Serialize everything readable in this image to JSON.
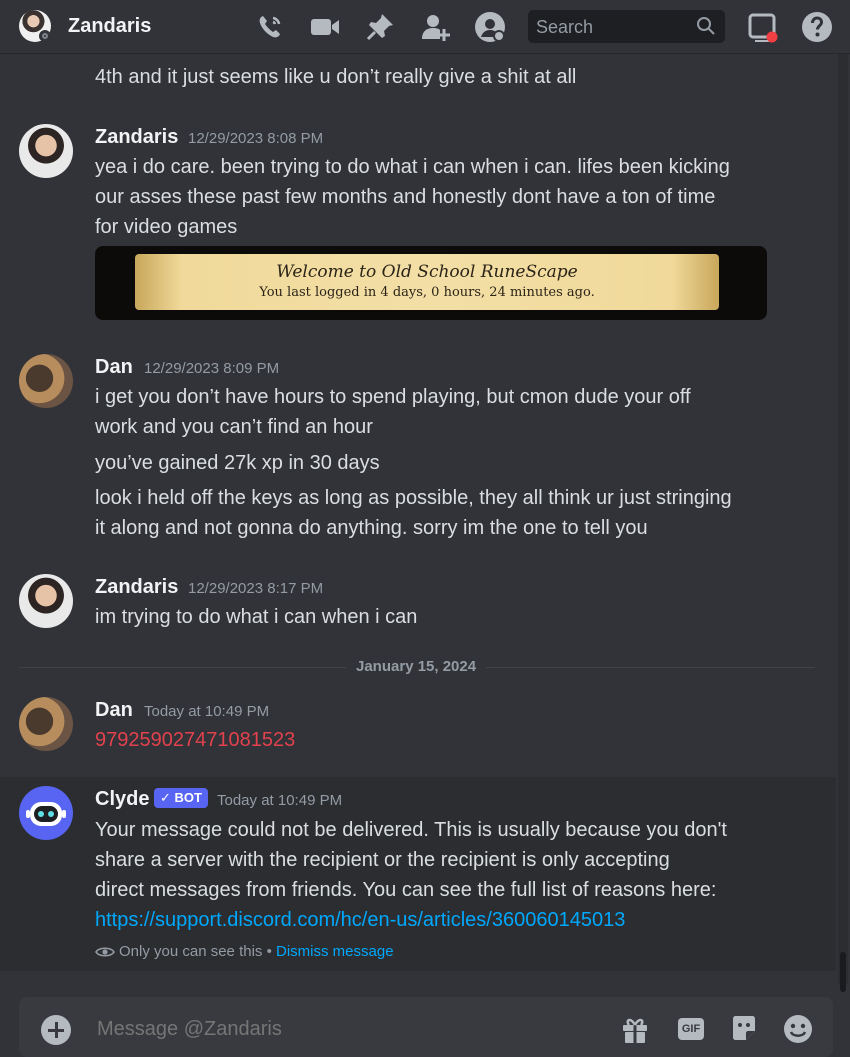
{
  "header": {
    "title": "Zandaris",
    "search_placeholder": "Search",
    "icons": [
      "voice-call-icon",
      "video-call-icon",
      "pin-icon",
      "add-friend-icon",
      "user-profile-icon",
      "search-icon",
      "inbox-icon",
      "help-icon"
    ]
  },
  "messages": {
    "partial_line": "4th and it just seems like u don’t really give a shit at all",
    "m1": {
      "author": "Zandaris",
      "time": "12/29/2023 8:08 PM",
      "line1": "yea i do care. been trying to do what i can when i can. lifes been kicking",
      "line2": "our asses these past few months and honestly dont have a ton of time",
      "line3": "for video games",
      "image_line1": "Welcome to Old School RuneScape",
      "image_line2": "You last logged in 4 days, 0 hours, 24 minutes ago."
    },
    "m2": {
      "author": "Dan",
      "time": "12/29/2023 8:09 PM",
      "line1": "i get you don’t have hours to spend playing, but cmon dude your off",
      "line2": "work and you can’t find an hour",
      "line3": "you’ve gained 27k xp in 30 days",
      "line4": "look i held off the keys as long as possible, they all think ur just stringing",
      "line5": "it along and not gonna do anything. sorry im the one to tell you"
    },
    "m3": {
      "author": "Zandaris",
      "time": "12/29/2023 8:17 PM",
      "line1": "im trying to do what i can when i can"
    },
    "divider_date": "January 15, 2024",
    "m4": {
      "author": "Dan",
      "time": "Today at 10:49 PM",
      "line1": "979259027471081523"
    },
    "m5": {
      "author": "Clyde",
      "badge": "✓ BOT",
      "time": "Today at 10:49 PM",
      "line1": "Your message could not be delivered. This is usually because you don't",
      "line2": "share a server with the recipient or the recipient is only accepting",
      "line3": "direct messages from friends. You can see the full list of reasons here:",
      "link": "https://support.discord.com/hc/en-us/articles/360060145013",
      "ephemeral_note": "Only you can see this",
      "separator": " • ",
      "dismiss": "Dismiss message"
    }
  },
  "composer": {
    "placeholder": "Message @Zandaris",
    "gif_label": "GIF"
  },
  "colors": {
    "background": "#313338",
    "accent": "#5865f2",
    "link": "#00a8fc",
    "error_text": "#e2414d"
  }
}
